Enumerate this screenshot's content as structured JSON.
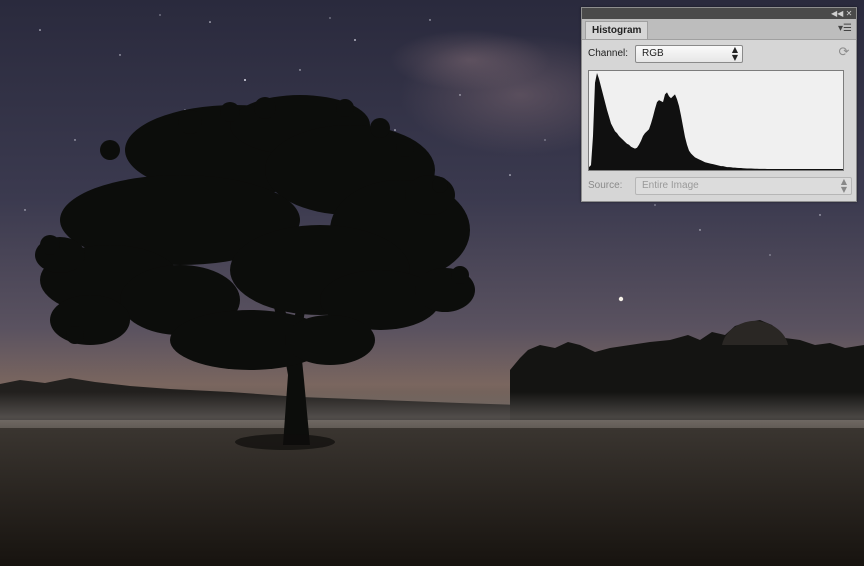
{
  "panel": {
    "title": "Histogram",
    "titlebar_icons": [
      "collapse-icon",
      "close-icon"
    ],
    "menu_icon": "panel-menu-icon",
    "channel": {
      "label": "Channel:",
      "value": "RGB"
    },
    "source": {
      "label": "Source:",
      "value": "Entire Image",
      "disabled": true
    },
    "refresh_icon": "refresh-icon",
    "histogram_levels": [
      0.03,
      0.05,
      0.35,
      0.9,
      1.0,
      0.94,
      0.86,
      0.78,
      0.7,
      0.62,
      0.55,
      0.48,
      0.44,
      0.4,
      0.38,
      0.35,
      0.33,
      0.31,
      0.29,
      0.27,
      0.26,
      0.24,
      0.23,
      0.22,
      0.23,
      0.26,
      0.3,
      0.35,
      0.38,
      0.4,
      0.42,
      0.48,
      0.55,
      0.63,
      0.7,
      0.72,
      0.71,
      0.7,
      0.78,
      0.8,
      0.76,
      0.74,
      0.76,
      0.78,
      0.73,
      0.66,
      0.56,
      0.45,
      0.34,
      0.26,
      0.2,
      0.17,
      0.15,
      0.13,
      0.12,
      0.11,
      0.1,
      0.09,
      0.08,
      0.075,
      0.07,
      0.065,
      0.06,
      0.055,
      0.05,
      0.045,
      0.04,
      0.04,
      0.035,
      0.03,
      0.03,
      0.028,
      0.025,
      0.024,
      0.022,
      0.02,
      0.02,
      0.018,
      0.017,
      0.016,
      0.015,
      0.015,
      0.014,
      0.013,
      0.013,
      0.012,
      0.012,
      0.011,
      0.011,
      0.01,
      0.01,
      0.01,
      0.01,
      0.01,
      0.01,
      0.01,
      0.01,
      0.01,
      0.01,
      0.01,
      0.01,
      0.01,
      0.01,
      0.01,
      0.01,
      0.01,
      0.01,
      0.01,
      0.01,
      0.01,
      0.01,
      0.01,
      0.01,
      0.01,
      0.01,
      0.01,
      0.01,
      0.01,
      0.01,
      0.01,
      0.01,
      0.01,
      0.01,
      0.01,
      0.01,
      0.01,
      0.01,
      0.01
    ]
  },
  "colors": {
    "sky_top": "#2b2b3e",
    "sky_mid": "#4a4a5e",
    "horizon": "#7a6660",
    "mist": "#6e6a66",
    "ground": "#1c1814",
    "tree": "#0c0d0b",
    "panel_bg": "#d6d6d6",
    "histogram_fill": "#101010"
  }
}
